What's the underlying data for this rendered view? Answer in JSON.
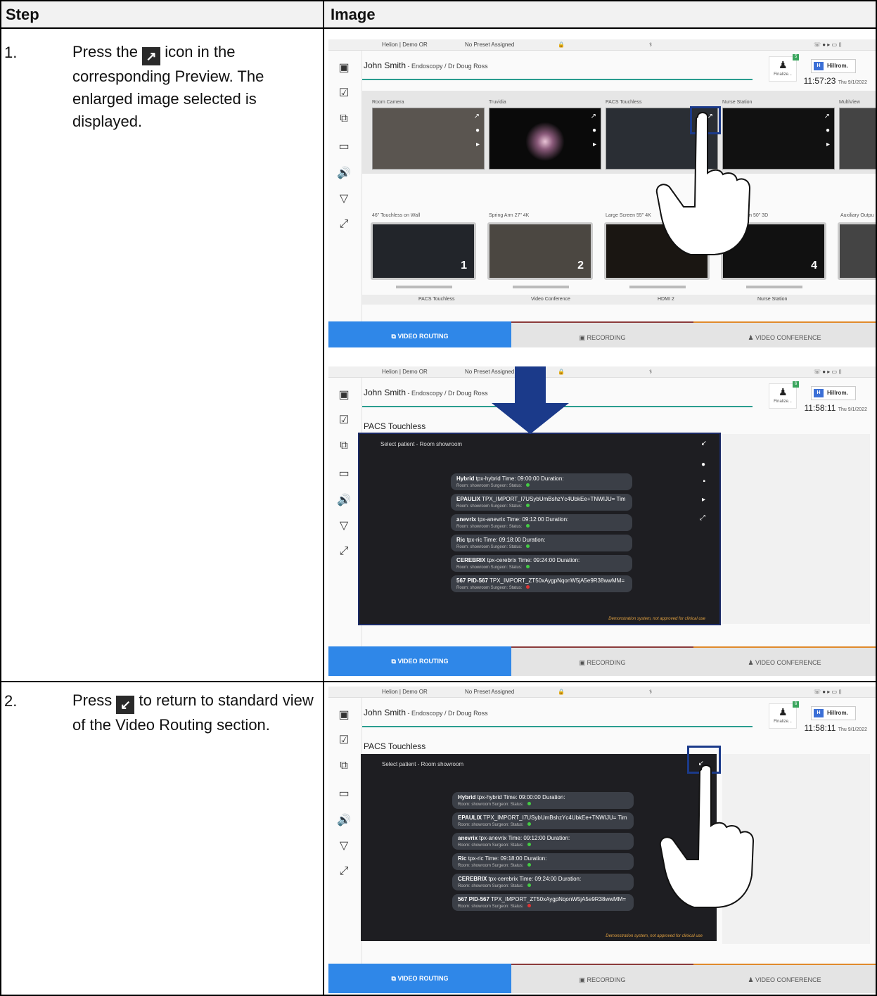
{
  "table": {
    "col_step": "Step",
    "col_image": "Image"
  },
  "steps": [
    {
      "num": "1.",
      "pre": "Press the",
      "icon": "↗",
      "post": "icon in the corresponding Preview.",
      "line2": "The enlarged image selected is displayed."
    },
    {
      "num": "2.",
      "pre": "Press",
      "icon": "↙",
      "post": "to return to standard view of the Video Routing section."
    }
  ],
  "ui": {
    "location": "Helion | Demo OR",
    "preset": "No Preset Assigned",
    "patient_name": "John Smith",
    "patient_detail": " - Endoscopy / Dr Doug Ross",
    "brand": "Hillrom.",
    "finalize": "Finalize...",
    "time1": "11:57:23",
    "time2": "11:58:11",
    "date": "Thu 9/1/2022",
    "badge1": "5",
    "badge2": "6",
    "previews": [
      "Room Camera",
      "Truvidia",
      "PACS Touchless",
      "Nurse Station",
      "MultiView"
    ],
    "monitors": [
      "46\" Touchless on Wall",
      "Spring Arm 27\" 4K",
      "Large Screen 55\" 4K",
      "e Screen 50\" 3D",
      "Auxiliary Outpu"
    ],
    "monitor_numbers": [
      "1",
      "2",
      "4"
    ],
    "sources": [
      "PACS Touchless",
      "Video Conference",
      "HDMI 2",
      "Nurse Station"
    ],
    "tabs": [
      "VIDEO ROUTING",
      "RECORDING",
      "VIDEO CONFERENCE"
    ],
    "enlarged_title": "PACS Touchless",
    "select_patient": "Select patient - Room showroom",
    "demo_note": "Demonstration system, not approved for clinical use",
    "patients": [
      {
        "name": "Hybrid",
        "id": "tpx-hybrid",
        "time": "Time: 09:00:00",
        "dur": "Duration:",
        "status": "g"
      },
      {
        "name": "EPAULIX",
        "id": "TPX_IMPORT_I7USybUmBshzYc4UbkEe+TNWIJU=",
        "time": "Tim",
        "dur": "",
        "status": "g"
      },
      {
        "name": "anevrix",
        "id": "tpx-anevrix",
        "time": "Time: 09:12:00",
        "dur": "Duration:",
        "status": "g"
      },
      {
        "name": "Ric",
        "id": "tpx-ric",
        "time": "Time: 09:18:00",
        "dur": "Duration:",
        "status": "g"
      },
      {
        "name": "CEREBRIX",
        "id": "tpx-cerebrix",
        "time": "Time: 09:24:00",
        "dur": "Duration:",
        "status": "g"
      },
      {
        "name": "567 PID-567",
        "id": "TPX_IMPORT_ZT50xAygpNqonW5jA5e9R38wwMM=",
        "time": "",
        "dur": "",
        "status": "r"
      }
    ],
    "patient_sub": "Room: showroom   Surgeon:   Status:"
  }
}
